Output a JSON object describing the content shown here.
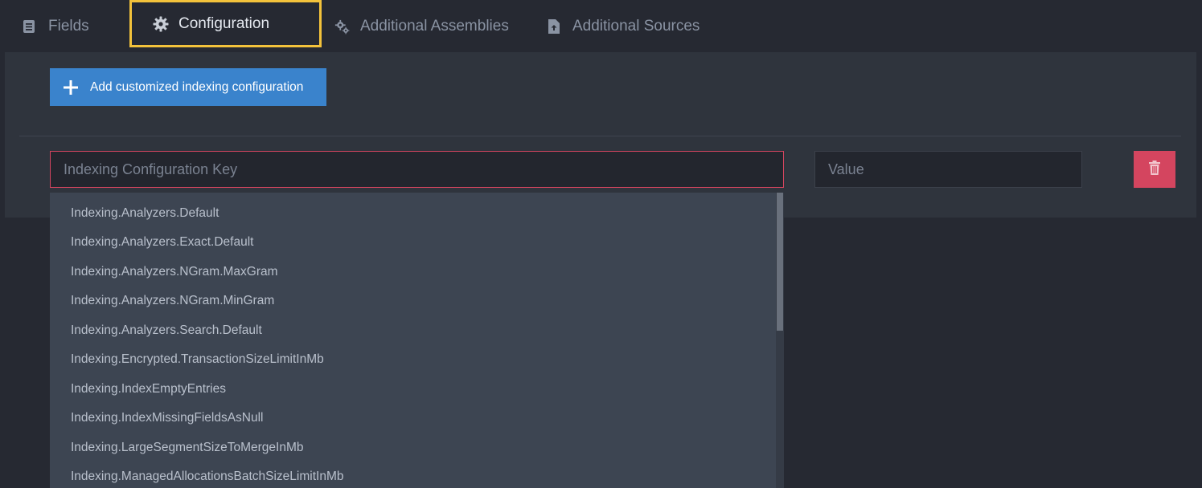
{
  "tabs": [
    {
      "label": "Fields",
      "icon": "list-icon",
      "active": false
    },
    {
      "label": "Configuration",
      "icon": "gear-icon",
      "active": true
    },
    {
      "label": "Additional Assemblies",
      "icon": "gears-icon",
      "active": false
    },
    {
      "label": "Additional Sources",
      "icon": "file-upload-icon",
      "active": false
    }
  ],
  "panel": {
    "add_button_label": "Add customized indexing configuration",
    "key_placeholder": "Indexing Configuration Key",
    "value_placeholder": "Value"
  },
  "dropdown": {
    "items": [
      "Indexing.Analyzers.Default",
      "Indexing.Analyzers.Exact.Default",
      "Indexing.Analyzers.NGram.MaxGram",
      "Indexing.Analyzers.NGram.MinGram",
      "Indexing.Analyzers.Search.Default",
      "Indexing.Encrypted.TransactionSizeLimitInMb",
      "Indexing.IndexEmptyEntries",
      "Indexing.IndexMissingFieldsAsNull",
      "Indexing.LargeSegmentSizeToMergeInMb",
      "Indexing.ManagedAllocationsBatchSizeLimitInMb"
    ]
  },
  "colors": {
    "accent_blue": "#3a83cc",
    "danger_red": "#d4455f",
    "highlight_yellow": "#f3c23b",
    "background": "#262932",
    "panel": "#2f343d"
  }
}
